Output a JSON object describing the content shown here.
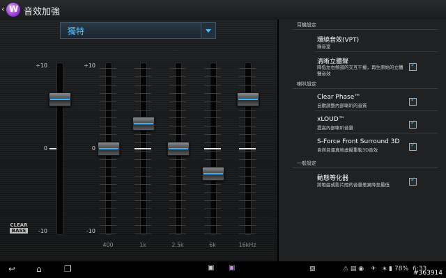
{
  "header": {
    "title": "音效加強",
    "back_icon": "chevron-left-icon",
    "app_icon": "walkman-icon"
  },
  "equalizer": {
    "preset": "獨特",
    "scale_max": "+10",
    "scale_zero": "0",
    "scale_min": "-10",
    "bands": [
      {
        "label": "400",
        "level": 0
      },
      {
        "label": "1k",
        "level": 3
      },
      {
        "label": "2.5k",
        "level": 0
      },
      {
        "label": "6k",
        "level": -3
      },
      {
        "label": "16kHz",
        "level": 6
      }
    ],
    "clear_bass": {
      "level": 6,
      "logo_top": "CLEAR",
      "logo_bottom": "BASS"
    }
  },
  "settings": {
    "headphone_section": "耳機設定",
    "vpt": {
      "title": "環繞音效(VPT)",
      "subtitle": "錄音室"
    },
    "clear_stereo": {
      "title": "清晰立體聲",
      "subtitle": "降低左右頻道的交互干擾，再生原始的立體聲音效",
      "checked": true
    },
    "speaker_section": "喇叭設定",
    "clear_phase": {
      "title": "Clear Phase™",
      "subtitle": "自動調整內部喇叭的音質",
      "checked": true
    },
    "xloud": {
      "title": "xLOUD™",
      "subtitle": "提高內部喇叭音量",
      "checked": true
    },
    "sforce": {
      "title": "S-Force Front Surround 3D",
      "subtitle": "自然且逼真地虛擬重製3D音效",
      "checked": true
    },
    "general_section": "一般設定",
    "dynamic_normalizer": {
      "title": "動態等化器",
      "subtitle": "將歌曲或影片間的音量差異降至最低",
      "checked": true
    }
  },
  "status": {
    "battery": "78%",
    "time": "6:33",
    "watermark": "#363914"
  }
}
